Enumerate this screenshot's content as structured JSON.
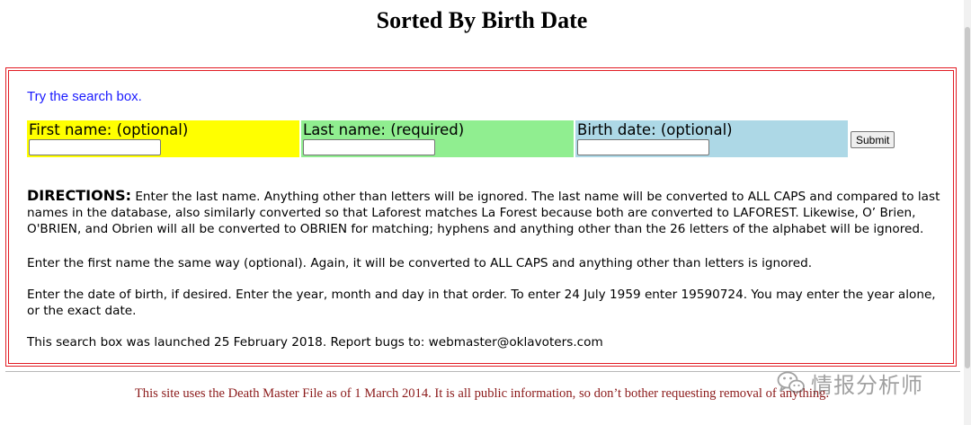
{
  "page": {
    "title": "Sorted By Birth Date"
  },
  "search": {
    "try_link": "Try the search box.",
    "fields": [
      {
        "label": "First name: (optional)",
        "value": "",
        "color": "#ffff00"
      },
      {
        "label": "Last name: (required)",
        "value": "",
        "color": "#90ee90"
      },
      {
        "label": "Birth date: (optional)",
        "value": "",
        "color": "#add8e6"
      }
    ],
    "submit_label": "Submit",
    "border_color": "#e21b23"
  },
  "directions": {
    "heading": "DIRECTIONS:",
    "p1": " Enter the last name. Anything other than letters will be ignored. The last name will be converted to ALL CAPS and compared to last names in the database, also similarly converted so that Laforest matches La Forest because both are converted to LAFOREST. Likewise, O’ Brien, O'BRIEN, and Obrien will all be converted to OBRIEN for matching; hyphens and anything other than the 26 letters of the alphabet will be ignored.",
    "p2": "Enter the first name the same way (optional). Again, it will be converted to ALL CAPS and anything other than letters is ignored.",
    "p3": "Enter the date of birth, if desired. Enter the year, month and day in that order. To enter 24 July 1959 enter 19590724. You may enter the year alone, or the exact date.",
    "p4": "This search box was launched 25 February 2018. Report bugs to: webmaster@oklavoters.com"
  },
  "footer": {
    "notice": "This site uses the Death Master File as of 1 March 2014. It is all public information, so don’t bother requesting removal of anything.",
    "notice_color": "#8b1a1a"
  },
  "watermark": {
    "text": "情报分析师",
    "icon": "wechat-icon"
  }
}
